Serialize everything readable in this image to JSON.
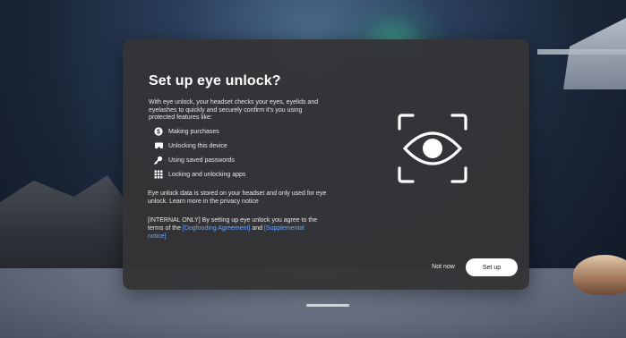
{
  "dialog": {
    "title": "Set up eye unlock?",
    "intro": "With eye unlock, your headset checks your eyes, eyelids and eyelashes to quickly and securely confirm it's you using protected features like:",
    "features": [
      {
        "icon": "dollar-icon",
        "label": "Making purchases"
      },
      {
        "icon": "headset-icon",
        "label": "Unlocking this device"
      },
      {
        "icon": "key-icon",
        "label": "Using saved passwords"
      },
      {
        "icon": "grid-icon",
        "label": "Locking and unlocking apps"
      }
    ],
    "storage_text": "Eye unlock data is stored on your headset and only used for eye unlock. Learn more in the privacy notice",
    "internal": {
      "prefix": "[INTERNAL ONLY] By setting up eye unlock you agree to the terms of the ",
      "link1": "[Dogfooding Agreement]",
      "middle": " and ",
      "link2": "[Supplemental notice]"
    },
    "buttons": {
      "not_now": "Not now",
      "set_up": "Set up"
    }
  },
  "colors": {
    "dialog_bg": "#343436",
    "link": "#6ea8ff",
    "primary_button_bg": "#ffffff"
  }
}
